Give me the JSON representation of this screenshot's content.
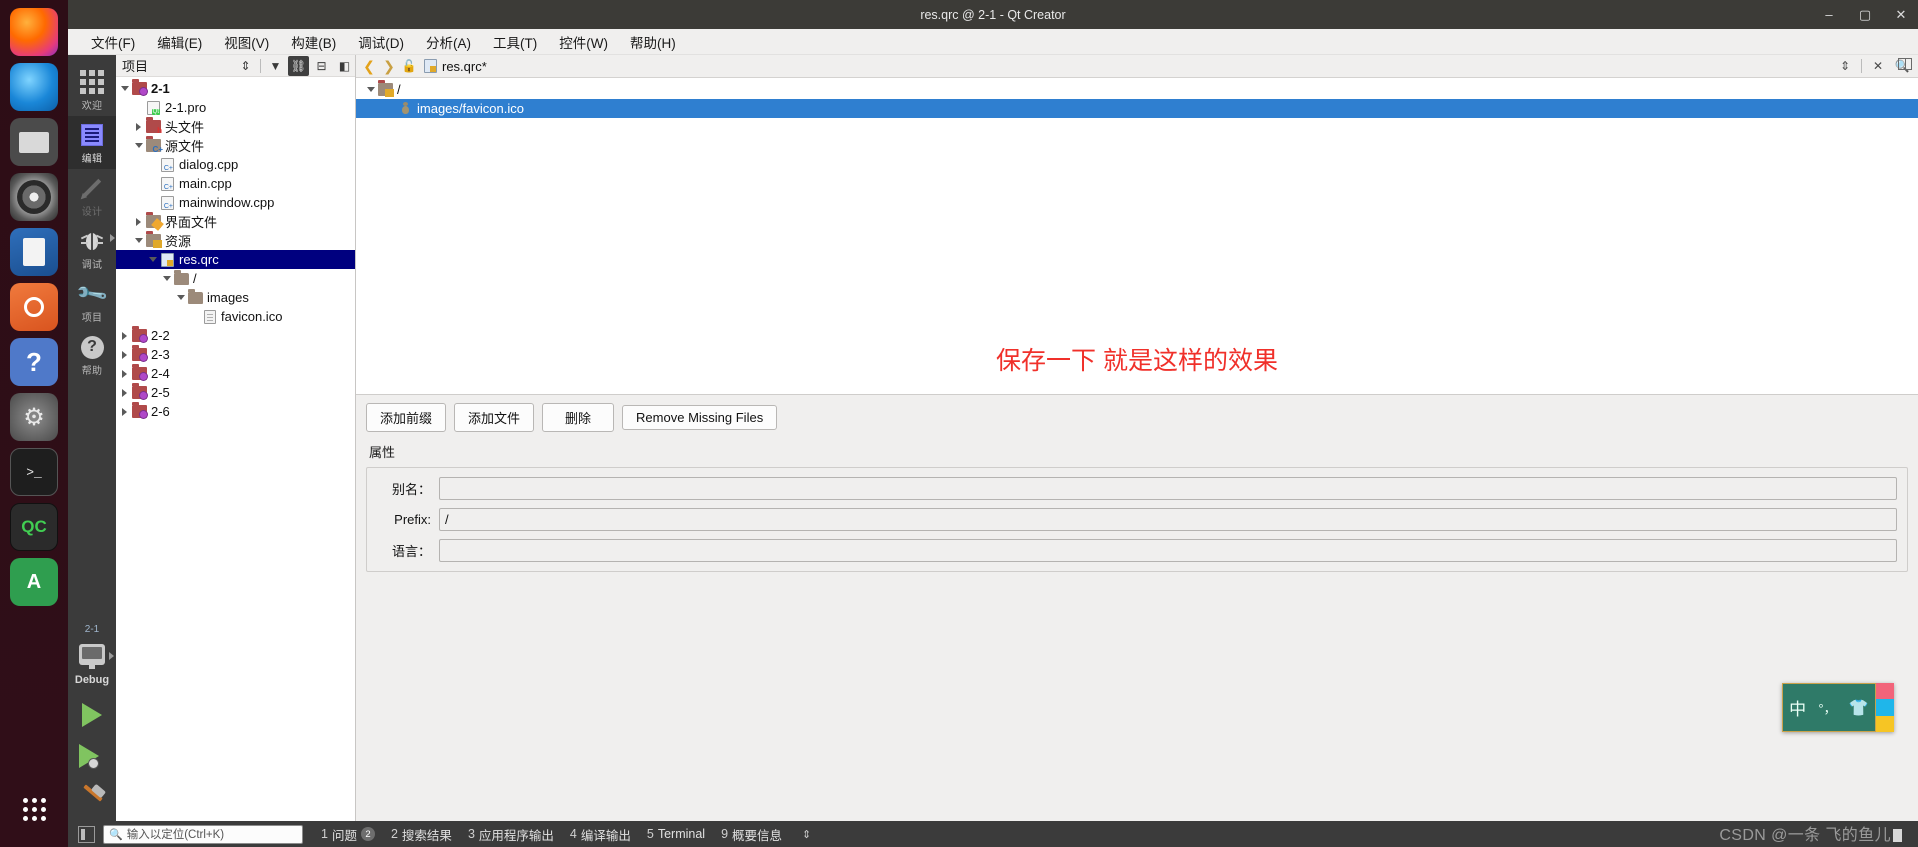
{
  "window": {
    "title": "res.qrc @ 2-1 - Qt Creator",
    "minimize": "–",
    "maximize": "▢",
    "close": "✕"
  },
  "launcher": {
    "items": [
      {
        "name": "firefox",
        "label": "Firefox"
      },
      {
        "name": "thunderbird",
        "label": "Thunderbird"
      },
      {
        "name": "files",
        "label": "Files"
      },
      {
        "name": "rhythmbox",
        "label": "Rhythmbox"
      },
      {
        "name": "libreoffice-writer",
        "label": "LibreOffice Writer"
      },
      {
        "name": "ubuntu-software",
        "label": "Ubuntu Software"
      },
      {
        "name": "help",
        "label": "Help"
      },
      {
        "name": "settings",
        "label": "Settings"
      },
      {
        "name": "terminal",
        "label": "Terminal"
      },
      {
        "name": "qtcreator",
        "label": "QC"
      },
      {
        "name": "android-studio",
        "label": "A"
      },
      {
        "name": "show-applications",
        "label": "Show Applications"
      }
    ],
    "qtc_badge": "QC",
    "android_badge": "A",
    "terminal_glyph": ">_"
  },
  "menubar": {
    "items": [
      {
        "label": "文件(F)",
        "mnemonic": "F"
      },
      {
        "label": "编辑(E)",
        "mnemonic": "E"
      },
      {
        "label": "视图(V)",
        "mnemonic": "V"
      },
      {
        "label": "构建(B)",
        "mnemonic": "B"
      },
      {
        "label": "调试(D)",
        "mnemonic": "D"
      },
      {
        "label": "分析(A)",
        "mnemonic": "A"
      },
      {
        "label": "工具(T)",
        "mnemonic": "T"
      },
      {
        "label": "控件(W)",
        "mnemonic": "W"
      },
      {
        "label": "帮助(H)",
        "mnemonic": "H"
      }
    ]
  },
  "modebar": {
    "modes": [
      {
        "label": "欢迎",
        "icon": "grid-icon",
        "state": "normal"
      },
      {
        "label": "编辑",
        "icon": "document-icon",
        "state": "active"
      },
      {
        "label": "设计",
        "icon": "pencil-icon",
        "state": "disabled"
      },
      {
        "label": "调试",
        "icon": "bug-icon",
        "state": "normal"
      },
      {
        "label": "项目",
        "icon": "wrench-icon",
        "state": "normal"
      },
      {
        "label": "帮助",
        "icon": "question-icon",
        "state": "normal"
      }
    ],
    "kit_name": "2-1",
    "build_config": "Debug",
    "run_label": "Run",
    "debug_label": "Start Debugging",
    "build_label": "Build"
  },
  "sidebar": {
    "title": "项目",
    "toolbar": [
      {
        "name": "sync-selection",
        "glyph": "⇕"
      },
      {
        "name": "filter",
        "glyph": "▼"
      },
      {
        "name": "link-with-editor",
        "glyph": "⛓",
        "active": true
      },
      {
        "name": "collapse-all",
        "glyph": "⊟"
      },
      {
        "name": "close-sidebar",
        "glyph": "◧"
      }
    ],
    "tree": [
      {
        "depth": 0,
        "label": "2-1",
        "icon": "project-folder-icon",
        "twist": "open",
        "bold": true,
        "selected": false
      },
      {
        "depth": 1,
        "label": "2-1.pro",
        "icon": "pro-file-icon",
        "twist": "none",
        "bold": false,
        "selected": false
      },
      {
        "depth": 1,
        "label": "头文件",
        "icon": "headers-folder-icon",
        "twist": "closed",
        "bold": false,
        "selected": false
      },
      {
        "depth": 1,
        "label": "源文件",
        "icon": "sources-folder-icon",
        "twist": "open",
        "bold": false,
        "selected": false
      },
      {
        "depth": 2,
        "label": "dialog.cpp",
        "icon": "cpp-file-icon",
        "twist": "none",
        "bold": false,
        "selected": false
      },
      {
        "depth": 2,
        "label": "main.cpp",
        "icon": "cpp-file-icon",
        "twist": "none",
        "bold": false,
        "selected": false
      },
      {
        "depth": 2,
        "label": "mainwindow.cpp",
        "icon": "cpp-file-icon",
        "twist": "none",
        "bold": false,
        "selected": false
      },
      {
        "depth": 1,
        "label": "界面文件",
        "icon": "forms-folder-icon",
        "twist": "closed",
        "bold": false,
        "selected": false
      },
      {
        "depth": 1,
        "label": "资源",
        "icon": "resources-folder-icon",
        "twist": "open",
        "bold": false,
        "selected": false
      },
      {
        "depth": 2,
        "label": "res.qrc",
        "icon": "qrc-file-icon",
        "twist": "open",
        "bold": false,
        "selected": true
      },
      {
        "depth": 3,
        "label": "/",
        "icon": "prefix-folder-icon",
        "twist": "open",
        "bold": false,
        "selected": false
      },
      {
        "depth": 4,
        "label": "images",
        "icon": "folder-icon",
        "twist": "open",
        "bold": false,
        "selected": false
      },
      {
        "depth": 5,
        "label": "favicon.ico",
        "icon": "file-icon",
        "twist": "none",
        "bold": false,
        "selected": false
      },
      {
        "depth": 0,
        "label": "2-2",
        "icon": "project-folder-icon",
        "twist": "closed",
        "bold": false,
        "selected": false
      },
      {
        "depth": 0,
        "label": "2-3",
        "icon": "project-folder-icon",
        "twist": "closed",
        "bold": false,
        "selected": false
      },
      {
        "depth": 0,
        "label": "2-4",
        "icon": "project-folder-icon",
        "twist": "closed",
        "bold": false,
        "selected": false
      },
      {
        "depth": 0,
        "label": "2-5",
        "icon": "project-folder-icon",
        "twist": "closed",
        "bold": false,
        "selected": false
      },
      {
        "depth": 0,
        "label": "2-6",
        "icon": "project-folder-icon",
        "twist": "closed",
        "bold": false,
        "selected": false
      }
    ]
  },
  "editor": {
    "nav_back": "❮",
    "nav_forward": "❯",
    "lock_icon": "🔓",
    "document_tab": "res.qrc*",
    "tab_controls": [
      {
        "name": "document-dropdown",
        "glyph": "⇕"
      },
      {
        "name": "close-document",
        "glyph": "✕"
      },
      {
        "name": "find-in-document",
        "glyph": "🔍"
      }
    ],
    "split_button": "◫",
    "qrc_tree": [
      {
        "depth": 0,
        "label": "/",
        "icon": "prefix-icon",
        "twist": "open",
        "selected": false
      },
      {
        "depth": 1,
        "label": "images/favicon.ico",
        "icon": "resource-item-icon",
        "twist": "none",
        "selected": true
      }
    ],
    "annotation": "保存一下 就是这样的效果",
    "annotation_color": "#f0302a",
    "buttons": [
      {
        "label": "添加前缀",
        "name": "add-prefix-button"
      },
      {
        "label": "添加文件",
        "name": "add-files-button"
      },
      {
        "label": "删除",
        "name": "remove-button"
      },
      {
        "label": "Remove Missing Files",
        "name": "remove-missing-files-button"
      }
    ],
    "properties_title": "属性",
    "properties": [
      {
        "label": "别名：",
        "value": "",
        "name": "alias-field"
      },
      {
        "label": "Prefix:",
        "value": "/",
        "name": "prefix-field"
      },
      {
        "label": "语言：",
        "value": "",
        "name": "language-field"
      }
    ]
  },
  "statusbar": {
    "sidebar_toggle": "◧",
    "locator_placeholder": "输入以定位(Ctrl+K)",
    "locator_icon": "search-icon",
    "panes": [
      {
        "num": "1",
        "label": "问题",
        "badge": "2"
      },
      {
        "num": "2",
        "label": "搜索结果",
        "badge": ""
      },
      {
        "num": "3",
        "label": "应用程序输出",
        "badge": ""
      },
      {
        "num": "4",
        "label": "编译输出",
        "badge": ""
      },
      {
        "num": "5",
        "label": "Terminal",
        "badge": ""
      },
      {
        "num": "9",
        "label": "概要信息",
        "badge": ""
      }
    ],
    "resize_glyph": "⇕"
  },
  "ime": {
    "mode": "中",
    "punctuation": "°，",
    "skin": "👕",
    "colors": {
      "top": "#f2647a",
      "middle": "#1fb6ea",
      "bottom": "#f6c524",
      "panel": "#2f7a68"
    }
  },
  "watermark": {
    "text": "CSDN @一条 飞的鱼儿"
  }
}
